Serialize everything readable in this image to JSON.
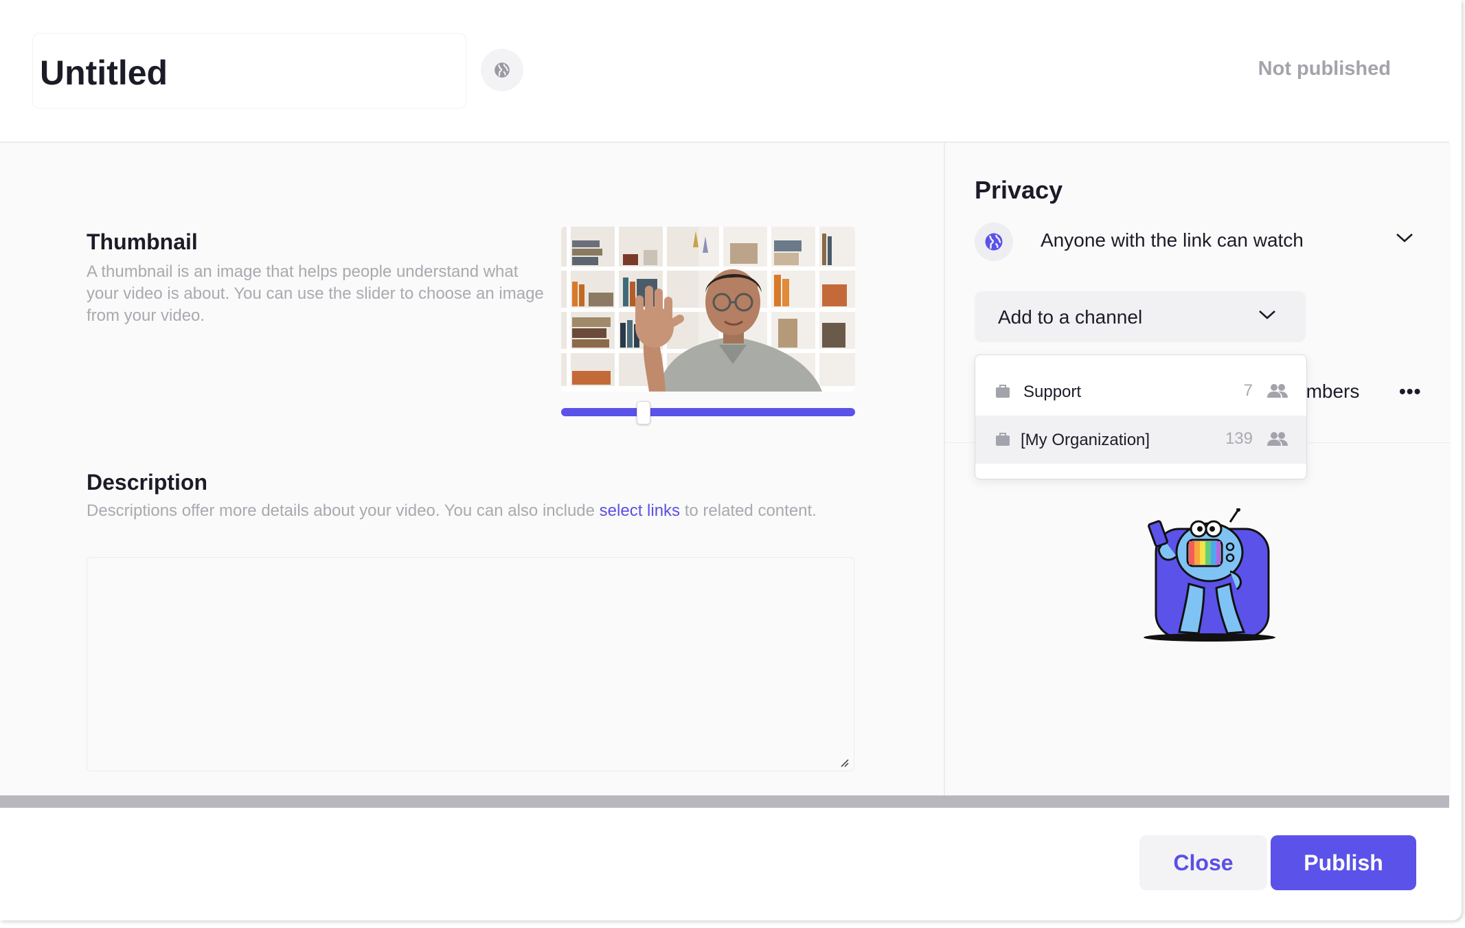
{
  "header": {
    "title": "Untitled",
    "status": "Not published"
  },
  "thumbnail": {
    "title": "Thumbnail",
    "description": "A thumbnail is an image that helps people understand what your video is about. You can use the slider to choose an image from your video.",
    "slider_position": 0.28
  },
  "description": {
    "title": "Description",
    "helper_before": "Descriptions offer more details about your video. You can also include ",
    "helper_link": "select links",
    "helper_after": " to related content.",
    "value": ""
  },
  "privacy": {
    "title": "Privacy",
    "selected": "Anyone with the link can watch",
    "channel_button": "Add to a channel",
    "members_partial": "embers",
    "more": "•••",
    "channels": [
      {
        "label": "Support",
        "count": "7"
      },
      {
        "label": "[My Organization]",
        "count": "139"
      }
    ]
  },
  "footer": {
    "close": "Close",
    "publish": "Publish"
  },
  "colors": {
    "accent": "#5b52ea",
    "muted_text": "#a9a9b0",
    "panel_bg": "#fafafa"
  },
  "icons": [
    "globe-icon",
    "chevron-down-icon",
    "briefcase-icon",
    "people-icon",
    "more-icon",
    "resize-handle-icon"
  ]
}
